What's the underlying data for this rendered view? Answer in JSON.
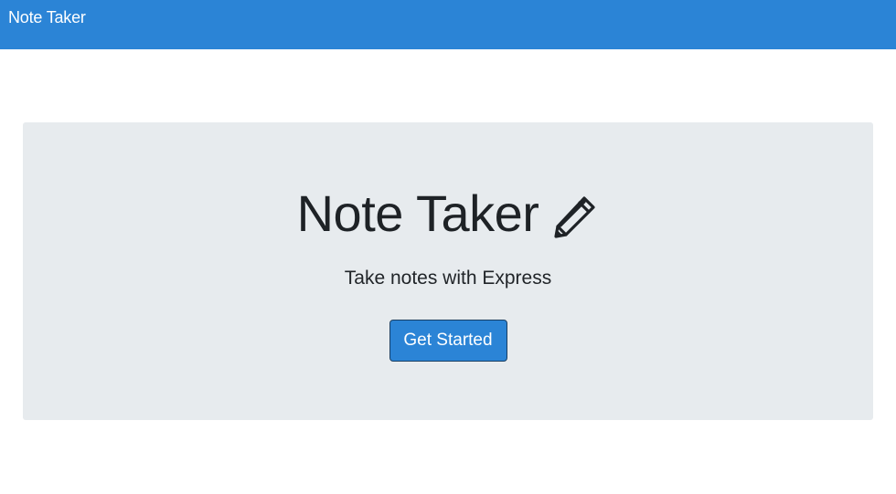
{
  "navbar": {
    "brand": "Note Taker",
    "background": "#2b84d6"
  },
  "hero": {
    "title": "Note Taker",
    "title_icon": "pencil-icon",
    "subtitle": "Take notes with Express",
    "cta_label": "Get Started",
    "background": "#e7ebee"
  }
}
